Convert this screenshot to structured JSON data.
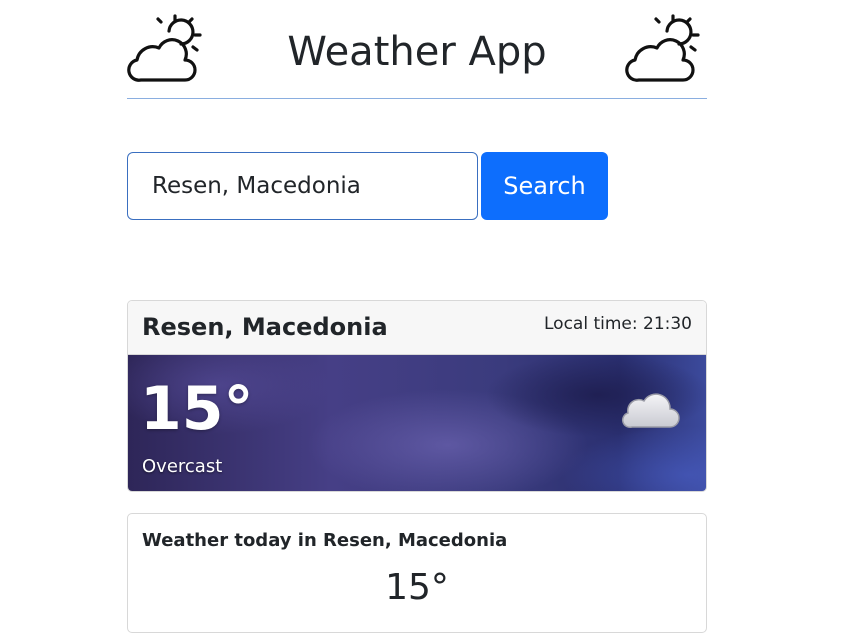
{
  "header": {
    "title": "Weather App",
    "left_icon": "partly-cloudy-icon",
    "right_icon": "partly-cloudy-icon"
  },
  "search": {
    "value": "Resen, Macedonia",
    "placeholder": "",
    "button_label": "Search"
  },
  "current": {
    "location": "Resen, Macedonia",
    "local_time": "Local time: 21:30",
    "temperature": "15°",
    "condition": "Overcast",
    "condition_icon": "cloud-icon"
  },
  "today": {
    "title": "Weather today in Resen, Macedonia",
    "temperature": "15°"
  },
  "colors": {
    "primary": "#0d6efd",
    "header_divider": "#8aaee0"
  }
}
